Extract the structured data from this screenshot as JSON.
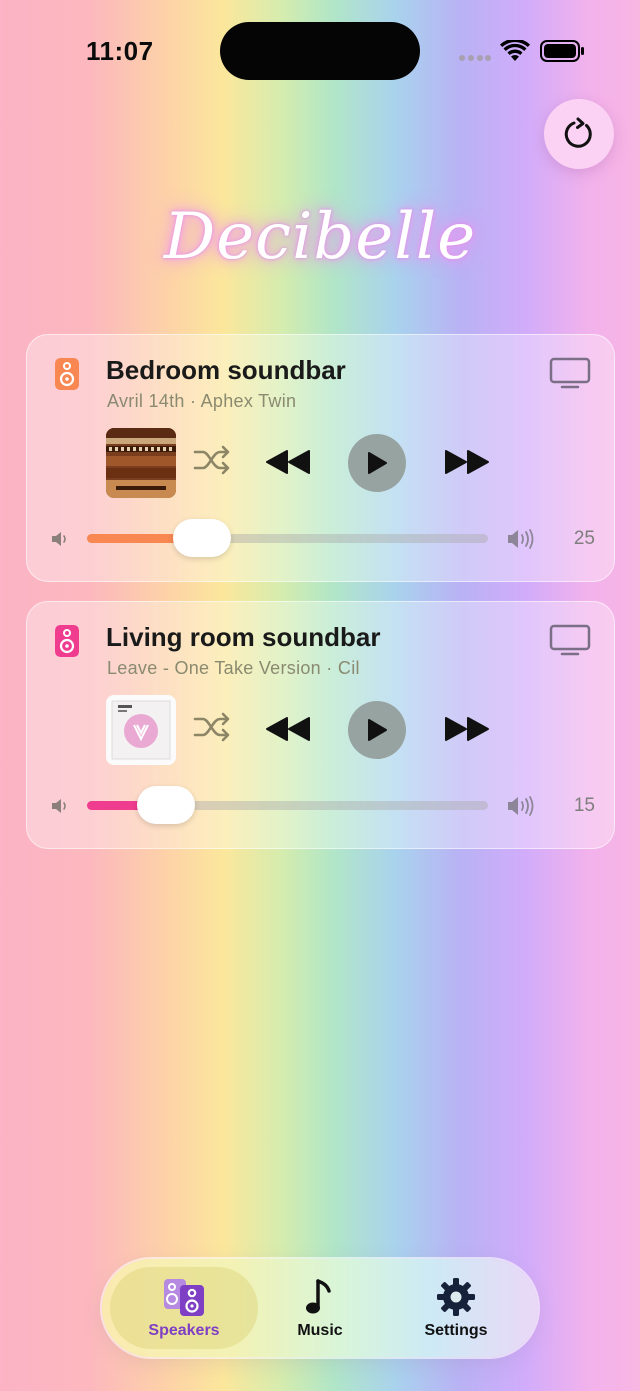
{
  "status_bar": {
    "time": "11:07"
  },
  "app": {
    "logo": "Decibelle"
  },
  "colors": {
    "bedroom_accent": "#f98752",
    "living_accent": "#f03c8f",
    "tab_active": "#7f3fc4"
  },
  "speakers": [
    {
      "name": "Bedroom soundbar",
      "now_playing": "Avril 14th · Aphex Twin",
      "volume": "25",
      "volume_fraction": 0.25,
      "icon": "speaker-icon",
      "output_icon": "tv-icon"
    },
    {
      "name": "Living room soundbar",
      "now_playing": "Leave - One Take Version · Cil",
      "volume": "15",
      "volume_fraction": 0.15,
      "icon": "speaker-icon",
      "output_icon": "tv-icon"
    }
  ],
  "tabs": [
    {
      "label": "Speakers",
      "icon": "speakers-icon",
      "active": true
    },
    {
      "label": "Music",
      "icon": "music-note-icon",
      "active": false
    },
    {
      "label": "Settings",
      "icon": "gear-icon",
      "active": false
    }
  ]
}
